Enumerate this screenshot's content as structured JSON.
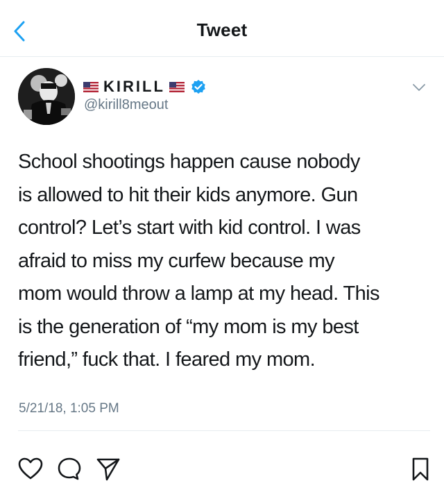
{
  "header": {
    "title": "Tweet",
    "back_icon": "chevron-left-icon"
  },
  "author": {
    "display_name": "KIRILL",
    "handle": "@kirill8meout",
    "verified": true,
    "flag_icon": "us-flag-icon"
  },
  "tweet": {
    "lines": [
      "School shootings happen cause nobody",
      "is allowed to hit their kids anymore. Gun",
      "control? Let’s start with kid control. I was",
      "afraid to miss my curfew because my",
      "mom would throw a lamp at my head. This",
      "is the generation of “my mom is my best",
      "friend,” fuck that. I feared my mom."
    ],
    "timestamp": "5/21/18, 1:05 PM"
  },
  "actions": [
    "heart-icon",
    "comment-icon",
    "share-icon",
    "bookmark-icon"
  ],
  "colors": {
    "accent": "#1da1f2",
    "secondary_text": "#657786",
    "divider": "#e6ecf0"
  }
}
